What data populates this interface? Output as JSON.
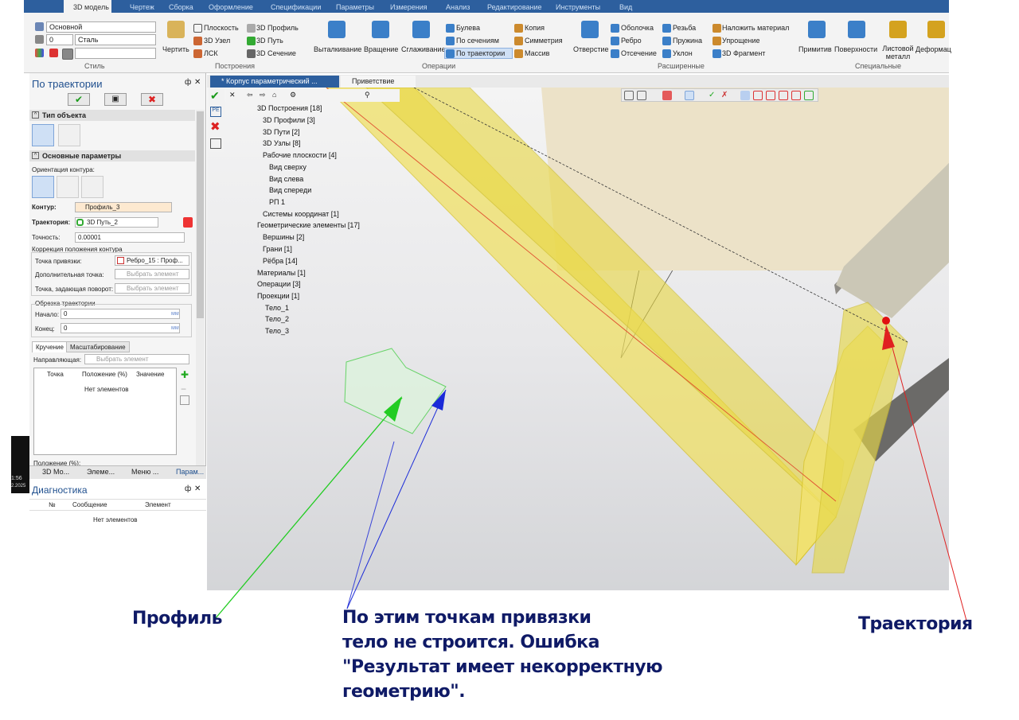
{
  "menu": [
    "3D модель",
    "Чертеж",
    "Сборка",
    "Оформление",
    "Спецификации",
    "Параметры",
    "Измерения",
    "Анализ",
    "Редактирование",
    "Инструменты",
    "Вид"
  ],
  "style_group": {
    "layer": "Основной",
    "number": "0",
    "material": "Сталь",
    "group_label": "Стиль"
  },
  "constructions": {
    "draw_label": "Чертить",
    "items": [
      "Плоскость",
      "3D Узел",
      "ЛСК",
      "3D Профиль",
      "3D Путь",
      "3D Сечение"
    ],
    "group_label": "Построения"
  },
  "operations": {
    "big": [
      "Выталкивание",
      "Вращение",
      "Сглаживание"
    ],
    "small": [
      "Булева",
      "По сечениям",
      "По траектории",
      "Копия",
      "Симметрия",
      "Массив"
    ],
    "group_label": "Операции"
  },
  "extended": {
    "big": "Отверстие",
    "small": [
      "Оболочка",
      "Ребро",
      "Отсечение",
      "Резьба",
      "Пружина",
      "Уклон",
      "Наложить материал",
      "Упрощение",
      "3D Фрагмент"
    ],
    "group_label": "Расширенные"
  },
  "special": {
    "items": [
      "Примитив",
      "Поверхности",
      "Листовой металл",
      "Деформац"
    ],
    "group_label": "Специальные"
  },
  "panel": {
    "title": "По траектории",
    "pin": "ф",
    "close": "✕",
    "section_type": "Тип объекта",
    "section_main": "Основные параметры",
    "orientation_label": "Ориентация контура:",
    "contour_label": "Контур:",
    "contour_value": "Профиль_3",
    "trajectory_label": "Траектория:",
    "trajectory_value": "3D Путь_2",
    "precision_label": "Точность:",
    "precision_value": "0.00001",
    "correction_title": "Коррекция положения контура",
    "anchor_label": "Точка привязки:",
    "anchor_value": "Ребро_15 : Проф...",
    "extra_point_label": "Дополнительная точка:",
    "rotation_point_label": "Точка, задающая поворот:",
    "select_placeholder": "Выбрать элемент",
    "trim_title": "Обрезка траектории",
    "start_label": "Начало:",
    "start_value": "0",
    "end_label": "Конец:",
    "end_value": "0",
    "unit": "мм",
    "tab_twist": "Кручение",
    "tab_scale": "Масштабирование",
    "guide_label": "Направляющая:",
    "col_point": "Точка",
    "col_position": "Положение (%)",
    "col_value": "Значение",
    "empty": "Нет элементов",
    "position_label": "Положение (%):"
  },
  "bottom_tabs": [
    "3D Мо...",
    "Элеме...",
    "Меню ...",
    "Парам..."
  ],
  "diag": {
    "title": "Диагностика",
    "col_num": "№",
    "col_msg": "Сообщение",
    "col_elem": "Элемент",
    "empty": "Нет элементов"
  },
  "doc_tabs": [
    "* Корпус параметрический ...",
    "Приветствие"
  ],
  "tree": [
    "3D Построения [18]",
    "3D Профили [3]",
    "3D Пути [2]",
    "3D Узлы [8]",
    "Рабочие плоскости [4]",
    "Вид сверху",
    "Вид слева",
    "Вид спереди",
    "РП 1",
    "Системы координат [1]",
    "Геометрические элементы [17]",
    "Вершины [2]",
    "Грани [1]",
    "Рёбра [14]",
    "Материалы [1]",
    "Операции [3]",
    "Проекции [1]",
    "Тело_1",
    "Тело_2",
    "Тело_3"
  ],
  "clock": {
    "time": "1:56",
    "date": "2.2025"
  },
  "annotations": {
    "profile": "Профиль",
    "trajectory": "Траектория",
    "note_lines": [
      "По этим точкам привязки",
      "тело не строится. Ошибка",
      "\"Результат имеет некорректную",
      "геометрию\"."
    ]
  },
  "colors": {
    "accent": "#2d5f9e",
    "body_yellow": "#f0e060",
    "note_text": "#0f1a66",
    "green_arrow": "#22cc22",
    "blue_arrow": "#1a2ad8",
    "red_arrow": "#e02020"
  }
}
